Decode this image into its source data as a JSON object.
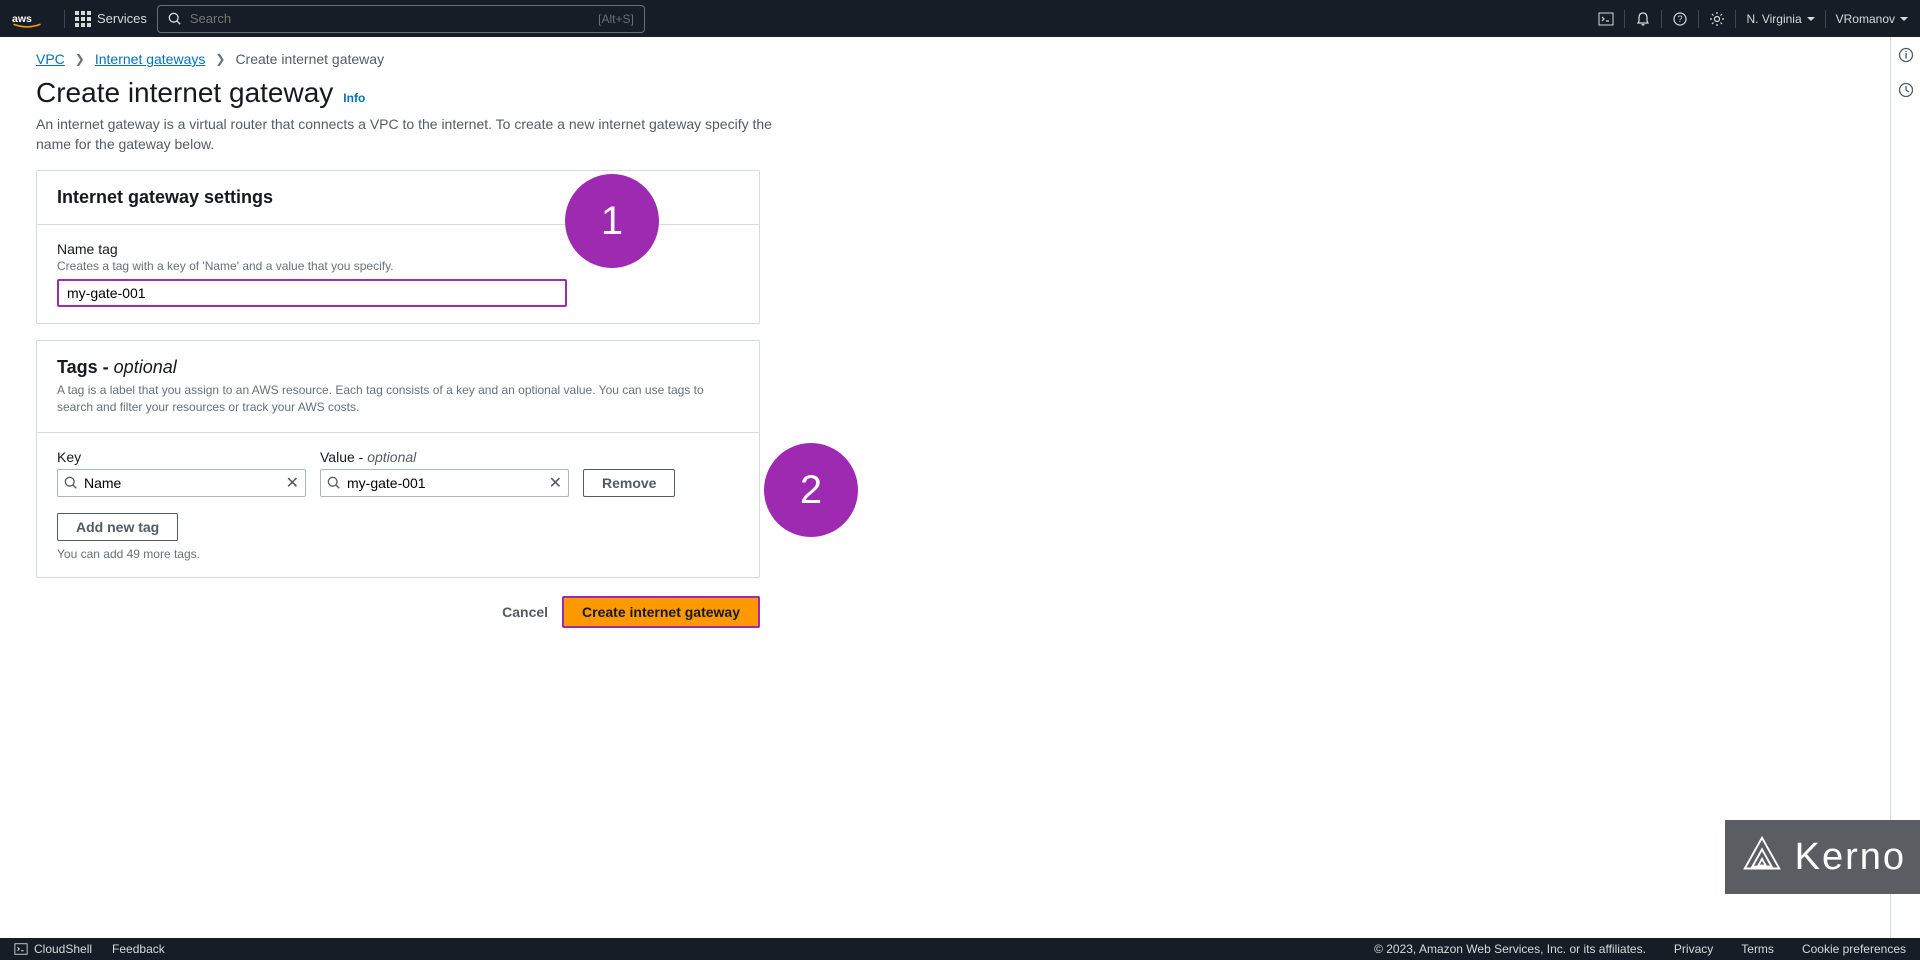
{
  "nav": {
    "services": "Services",
    "search_placeholder": "Search",
    "search_shortcut": "[Alt+S]",
    "region": "N. Virginia",
    "user": "VRomanov"
  },
  "breadcrumb": {
    "vpc": "VPC",
    "igw": "Internet gateways",
    "current": "Create internet gateway"
  },
  "page": {
    "title": "Create internet gateway",
    "info": "Info",
    "desc": "An internet gateway is a virtual router that connects a VPC to the internet. To create a new internet gateway specify the name for the gateway below."
  },
  "settings": {
    "panel_title": "Internet gateway settings",
    "name_label": "Name tag",
    "name_hint": "Creates a tag with a key of 'Name' and a value that you specify.",
    "name_value": "my-gate-001"
  },
  "tags": {
    "title": "Tags - ",
    "optional": "optional",
    "desc": "A tag is a label that you assign to an AWS resource. Each tag consists of a key and an optional value. You can use tags to search and filter your resources or track your AWS costs.",
    "key_label": "Key",
    "value_label": "Value - ",
    "value_optional": "optional",
    "key_value": "Name",
    "value_value": "my-gate-001",
    "remove": "Remove",
    "add": "Add new tag",
    "limit": "You can add 49 more tags."
  },
  "actions": {
    "cancel": "Cancel",
    "create": "Create internet gateway"
  },
  "annotations": {
    "one": "1",
    "two": "2"
  },
  "watermark": "Kerno",
  "footer": {
    "cloudshell": "CloudShell",
    "feedback": "Feedback",
    "copyright": "© 2023, Amazon Web Services, Inc. or its affiliates.",
    "privacy": "Privacy",
    "terms": "Terms",
    "cookies": "Cookie preferences"
  }
}
